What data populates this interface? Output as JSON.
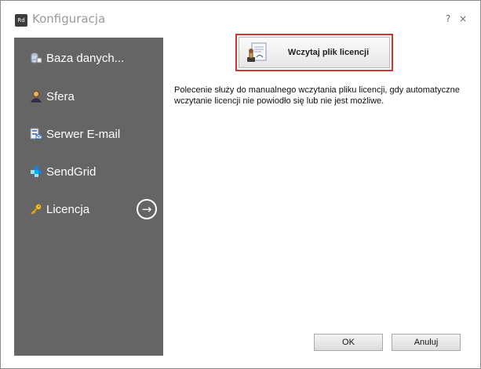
{
  "window": {
    "app_icon_text": "Rd",
    "title": "Konfiguracja",
    "help_glyph": "?",
    "close_glyph": "×"
  },
  "sidebar": {
    "items": [
      {
        "label": "Baza danych...",
        "icon": "database-icon"
      },
      {
        "label": "Sfera",
        "icon": "person-icon"
      },
      {
        "label": "Serwer E-mail",
        "icon": "email-server-icon"
      },
      {
        "label": "SendGrid",
        "icon": "sendgrid-icon"
      },
      {
        "label": "Licencja",
        "icon": "key-icon"
      }
    ],
    "active_arrow_glyph": "→"
  },
  "main": {
    "load_button_label": "Wczytaj plik licencji",
    "description": "Polecenie służy do manualnego wczytania pliku licencji, gdy automatyczne wczytanie licencji nie powiodło się lub nie jest możliwe."
  },
  "footer": {
    "ok_label": "OK",
    "cancel_label": "Anuluj"
  },
  "colors": {
    "sidebar": "#656565",
    "highlight_border": "#d43333",
    "title_text": "#9a9a9a"
  }
}
